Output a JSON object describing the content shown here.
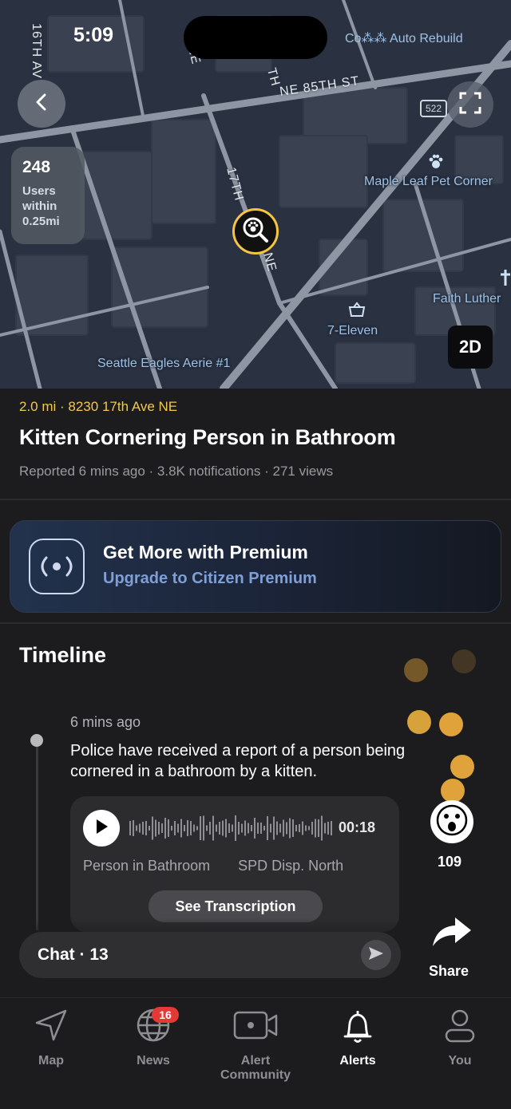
{
  "status_bar": {
    "time": "5:09",
    "right_text": "Co⁂⁂ Auto Rebuild"
  },
  "map": {
    "streets": {
      "ne_85th": "NE 85TH ST",
      "th_16": "16TH AV",
      "th_17": "17TH",
      "ne_a": "NE",
      "ne_b": "NE",
      "th_top": "TH",
      "route": "522"
    },
    "pois": {
      "maple_leaf": "Maple Leaf Pet Corner",
      "faith": "Faith Luther",
      "seven_eleven": "7-Eleven",
      "seattle_eagles": "Seattle Eagles Aerie #1"
    },
    "users_card": {
      "count": "248",
      "line1": "Users",
      "line2": "within",
      "line3": "0.25mi"
    },
    "view_toggle": "2D"
  },
  "incident": {
    "location": "2.0 mi · 8230 17th Ave NE",
    "title": "Kitten Cornering Person in Bathroom",
    "meta": "Reported 6 mins ago · 3.8K notifications · 271 views"
  },
  "premium": {
    "title": "Get More with Premium",
    "subtitle": "Upgrade to Citizen Premium"
  },
  "timeline": {
    "heading": "Timeline",
    "entry": {
      "time": "6 mins ago",
      "text": "Police have received a report of a person being cornered in a bathroom by a kitten.",
      "audio": {
        "duration": "00:18",
        "source": "Person in Bathroom",
        "channel": "SPD Disp. North",
        "transcript_button": "See Transcription"
      }
    }
  },
  "reactions": {
    "count": "109"
  },
  "chat": {
    "label": "Chat · 13"
  },
  "share": {
    "label": "Share"
  },
  "tabs": [
    {
      "label": "Map",
      "icon": "navigation-arrow-icon"
    },
    {
      "label": "News",
      "icon": "globe-icon",
      "badge": "16"
    },
    {
      "label": "Alert Community",
      "icon": "video-camera-icon"
    },
    {
      "label": "Alerts",
      "icon": "bell-icon"
    },
    {
      "label": "You",
      "icon": "person-icon"
    }
  ],
  "colors": {
    "accent_yellow": "#f2c94c",
    "premium_blue": "#7f9fd6",
    "badge_red": "#e53935"
  }
}
